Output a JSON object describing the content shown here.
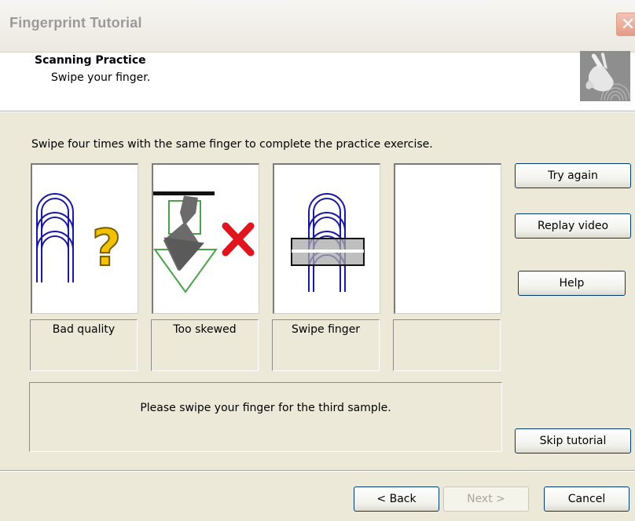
{
  "window": {
    "title": "Fingerprint Tutorial",
    "close_symbol": "✕"
  },
  "header": {
    "title": "Scanning Practice",
    "subtitle": "Swipe your finger.",
    "image_icon": "hand-fingerprint-image"
  },
  "instruction": "Swipe four times with the same finger to complete the practice exercise.",
  "samples": [
    {
      "icon": "fingerprint-question-icon",
      "caption": "Bad quality"
    },
    {
      "icon": "skewed-arrow-x-icon",
      "caption": "Too skewed"
    },
    {
      "icon": "fingerprint-swipe-icon",
      "caption": "Swipe finger"
    },
    {
      "icon": "",
      "caption": ""
    }
  ],
  "message": "Please swipe your finger for the third sample.",
  "side_buttons": {
    "try_again": "Try again",
    "replay_video": "Replay video",
    "help": "Help",
    "skip_tutorial": "Skip tutorial"
  },
  "footer_buttons": {
    "back": "< Back",
    "next": "Next >",
    "cancel": "Cancel"
  },
  "colors": {
    "fingerprint_arc": "#1a1aa0",
    "question_mark": "#f2c200",
    "error_x": "#e0141e",
    "outline_green": "#4aa24a"
  }
}
